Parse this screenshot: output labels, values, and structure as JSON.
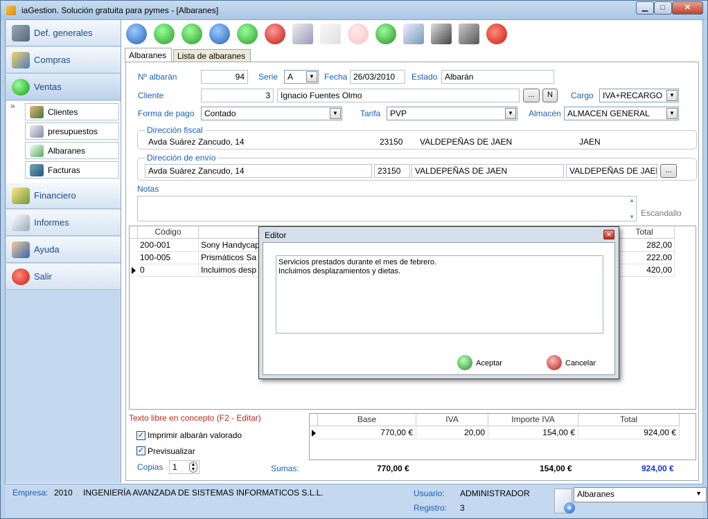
{
  "window": {
    "title": "iaGestion. Solución gratuita para pymes - [Albaranes]",
    "min_icon": "minimize-icon",
    "max_icon": "maximize-icon",
    "close_icon": "close-icon"
  },
  "sidebar": {
    "items": [
      {
        "label": "Def. generales",
        "icon": "settings-icon"
      },
      {
        "label": "Compras",
        "icon": "truck-icon"
      },
      {
        "label": "Ventas",
        "icon": "green-ball-icon"
      },
      {
        "label": "Financiero",
        "icon": "money-icon"
      },
      {
        "label": "Informes",
        "icon": "report-icon"
      },
      {
        "label": "Ayuda",
        "icon": "help-icon"
      },
      {
        "label": "Salir",
        "icon": "power-icon"
      }
    ],
    "ventas_sub": [
      {
        "label": "Clientes",
        "icon": "clients-icon"
      },
      {
        "label": "presupuestos",
        "icon": "budget-icon"
      },
      {
        "label": "Albaranes",
        "icon": "delivery-note-icon"
      },
      {
        "label": "Facturas",
        "icon": "invoice-icon"
      }
    ],
    "collapse_glyph": "»"
  },
  "toolbar": [
    "first-record-icon",
    "previous-record-icon",
    "next-record-icon",
    "last-record-icon",
    "add-record-icon",
    "delete-record-icon",
    "edit-record-icon",
    "save-record-icon",
    "cancel-record-icon",
    "refresh-icon",
    "search-icon",
    "filter-icon",
    "print-icon",
    "exit-icon"
  ],
  "tabs": [
    "Albaranes",
    "Lista de albaranes"
  ],
  "form": {
    "num_label": "Nº albarán",
    "num_value": "94",
    "serie_label": "Serie",
    "serie_value": "A",
    "fecha_label": "Fecha",
    "fecha_value": "26/03/2010",
    "estado_label": "Estado",
    "estado_value": "Albarán",
    "cliente_label": "Cliente",
    "cliente_code": "3",
    "cliente_name": "Ignacio Fuentes Olmo",
    "dots": "...",
    "n_button": "N",
    "cargo_label": "Cargo",
    "cargo_value": "IVA+RECARGO",
    "forma_label": "Forma de pago",
    "forma_value": "Contado",
    "tarifa_label": "Tarifa",
    "tarifa_value": "PVP",
    "almacen_label": "Almacén",
    "almacen_value": "ALMACEN GENERAL",
    "fiscal_title": "Dirección fiscal",
    "fiscal": {
      "street": "Avda Suárez Zancudo, 14",
      "cp": "23150",
      "city": "VALDEPEÑAS DE JAEN",
      "prov": "JAEN"
    },
    "envio_title": "Dirección de envío",
    "envio": {
      "street": "Avda Suárez Zancudo, 14",
      "cp": "23150",
      "city": "VALDEPEÑAS DE JAEN",
      "prov": "VALDEPEÑAS DE JAEN"
    },
    "notas_label": "Notas",
    "escandallo": "Escandallo"
  },
  "grid": {
    "headers": {
      "codigo": "Código",
      "total": "Total"
    },
    "rows": [
      {
        "code": "200-001",
        "desc": "Sony Handycap",
        "total": "282,00"
      },
      {
        "code": "100-005",
        "desc": "Prismáticos Sa",
        "total": "222,00"
      },
      {
        "code": "0",
        "desc": "Incluimos desp",
        "total": "420,00"
      }
    ]
  },
  "dialog": {
    "title": "Editor",
    "text": "Servicios prestados durante el mes de febrero.\nIncluimos desplazamientos y dietas.",
    "ok": "Aceptar",
    "cancel": "Cancelar"
  },
  "bottom": {
    "texto_libre": "Texto libre en concepto (F2 - Editar)",
    "imprimir": "Imprimir albarán valorado",
    "previsualizar": "Previsualizar",
    "copias_label": "Copias",
    "copias_value": "1",
    "sumas": "Sumas:"
  },
  "totals": {
    "headers": [
      "Base",
      "IVA",
      "Importe IVA",
      "Total"
    ],
    "row": [
      "770,00 €",
      "20,00",
      "154,00 €",
      "924,00 €"
    ],
    "sums": {
      "base": "770,00 €",
      "importe": "154,00 €",
      "total": "924,00 €"
    }
  },
  "status": {
    "empresa_label": "Empresa:",
    "empresa_year": "2010",
    "empresa_name": "INGENIERÍA AVANZADA DE SISTEMAS INFORMATICOS S.L.L.",
    "usuario_label": "Usuario:",
    "usuario_value": "ADMINISTRADOR",
    "registro_label": "Registro:",
    "registro_value": "3",
    "module_select": "Albaranes"
  }
}
